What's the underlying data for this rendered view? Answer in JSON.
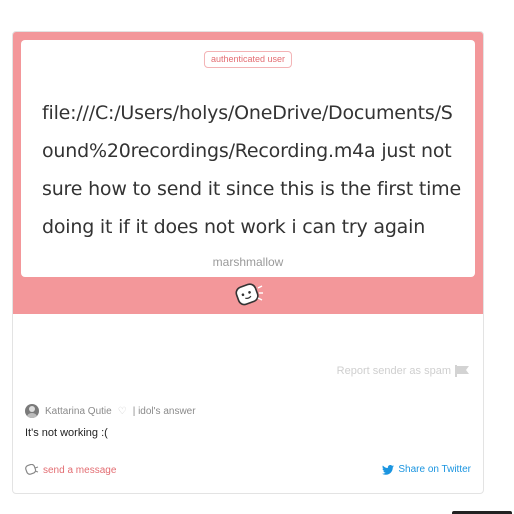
{
  "card": {
    "badge": "authenticated user",
    "message": "file:///C:/Users/holys/OneDrive/Documents/Sound%20recordings/Recording.m4a just not sure how to send it since this is the first time doing it if it does not work i can try again",
    "signature": "marshmallow"
  },
  "footer": {
    "report_label": "Report sender as spam",
    "answerer_name": "Kattarina Qutie",
    "answerer_tag": "| idol's answer",
    "answer_text": "It's not working :(",
    "send_label": "send a message",
    "twitter_label": "Share on Twitter"
  },
  "colors": {
    "accent_pink": "#f3979a",
    "badge_text": "#e36d72",
    "twitter_blue": "#1b95e0"
  },
  "icons": [
    "marshmallow-icon",
    "flag-icon",
    "heart-icon",
    "send-icon",
    "twitter-icon"
  ]
}
